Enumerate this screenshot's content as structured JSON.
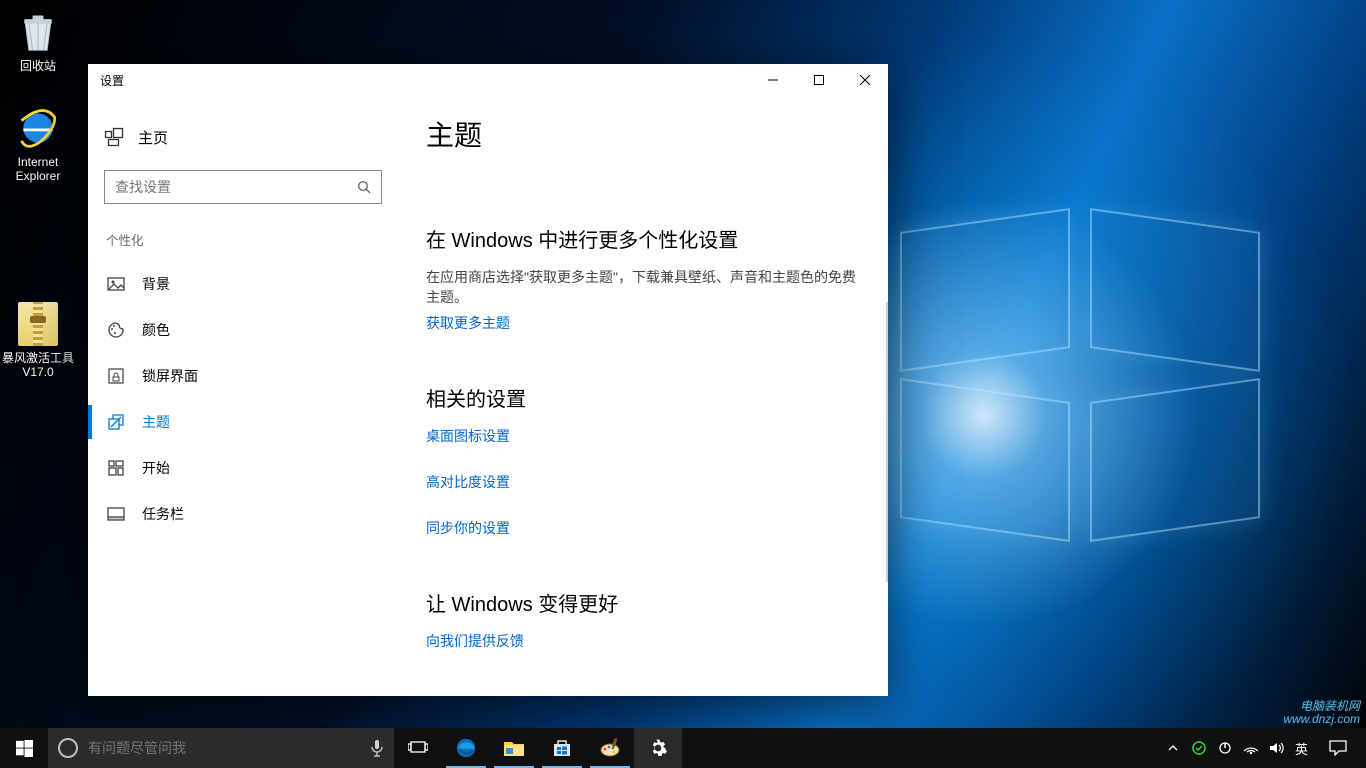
{
  "desktop": {
    "icons": [
      {
        "name": "recycle-bin",
        "label": "回收站"
      },
      {
        "name": "internet-explorer",
        "label": "Internet Explorer"
      },
      {
        "name": "activation-tool",
        "label": "暴风激活工具V17.0"
      }
    ]
  },
  "settings_window": {
    "title": "设置",
    "home_label": "主页",
    "search_placeholder": "查找设置",
    "sidebar": {
      "group_label": "个性化",
      "items": [
        {
          "key": "background",
          "label": "背景"
        },
        {
          "key": "colors",
          "label": "颜色"
        },
        {
          "key": "lockscreen",
          "label": "锁屏界面"
        },
        {
          "key": "themes",
          "label": "主题",
          "active": true
        },
        {
          "key": "start",
          "label": "开始"
        },
        {
          "key": "taskbar",
          "label": "任务栏"
        }
      ]
    },
    "content": {
      "heading": "主题",
      "more_settings_heading": "在 Windows 中进行更多个性化设置",
      "more_settings_desc": "在应用商店选择\"获取更多主题\"，下载兼具壁纸、声音和主题色的免费主题。",
      "get_more_link": "获取更多主题",
      "related_heading": "相关的设置",
      "related_links": {
        "desktop_icons": "桌面图标设置",
        "high_contrast": "高对比度设置",
        "sync_settings": "同步你的设置"
      },
      "feedback_heading": "让 Windows 变得更好",
      "feedback_link": "向我们提供反馈"
    }
  },
  "taskbar": {
    "search_placeholder": "有问题尽管问我",
    "ime_lang": "英",
    "watermark_line1": "电脑装机网",
    "watermark_line2": "www.dnzj.com"
  }
}
